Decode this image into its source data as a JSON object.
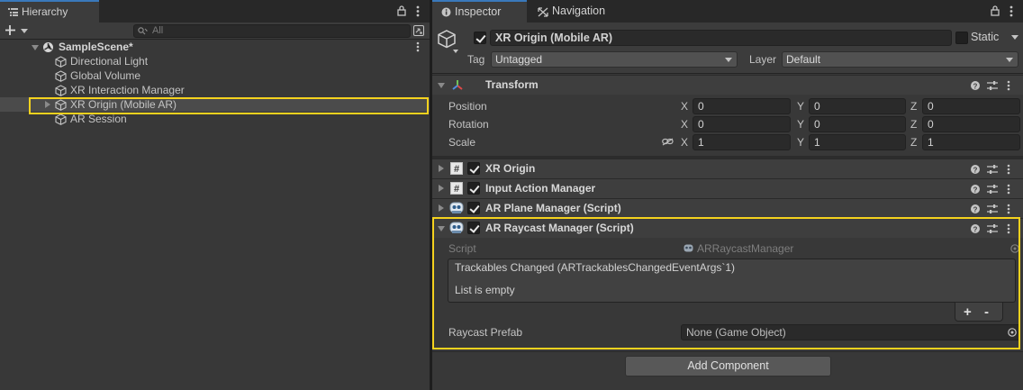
{
  "hierarchy": {
    "tab_label": "Hierarchy",
    "search_placeholder": "All",
    "scene_name": "SampleScene*",
    "items": [
      {
        "label": "Directional Light"
      },
      {
        "label": "Global Volume"
      },
      {
        "label": "XR Interaction Manager"
      },
      {
        "label": "XR Origin (Mobile AR)"
      },
      {
        "label": "AR Session"
      }
    ]
  },
  "inspector": {
    "tabs": [
      {
        "label": "Inspector"
      },
      {
        "label": "Navigation"
      }
    ],
    "object_name": "XR Origin (Mobile AR)",
    "static_label": "Static",
    "tag_label": "Tag",
    "tag_value": "Untagged",
    "layer_label": "Layer",
    "layer_value": "Default",
    "transform": {
      "title": "Transform",
      "rows": [
        {
          "label": "Position",
          "x": "0",
          "y": "0",
          "z": "0"
        },
        {
          "label": "Rotation",
          "x": "0",
          "y": "0",
          "z": "0"
        },
        {
          "label": "Scale",
          "x": "1",
          "y": "1",
          "z": "1"
        }
      ],
      "axis_x": "X",
      "axis_y": "Y",
      "axis_z": "Z"
    },
    "components": [
      {
        "title": "XR Origin"
      },
      {
        "title": "Input Action Manager"
      },
      {
        "title": "AR Plane Manager (Script)"
      },
      {
        "title": "AR Raycast Manager (Script)"
      }
    ],
    "raycast": {
      "script_label": "Script",
      "script_value": "ARRaycastManager",
      "event_title": "Trackables Changed (ARTrackablesChangedEventArgs`1)",
      "event_empty": "List is empty",
      "plus": "+",
      "minus": "-",
      "prefab_label": "Raycast Prefab",
      "prefab_value": "None (Game Object)"
    },
    "add_component": "Add Component"
  },
  "colors": {
    "highlight": "#f5d21e",
    "tab_accent": "#3a79bb"
  }
}
